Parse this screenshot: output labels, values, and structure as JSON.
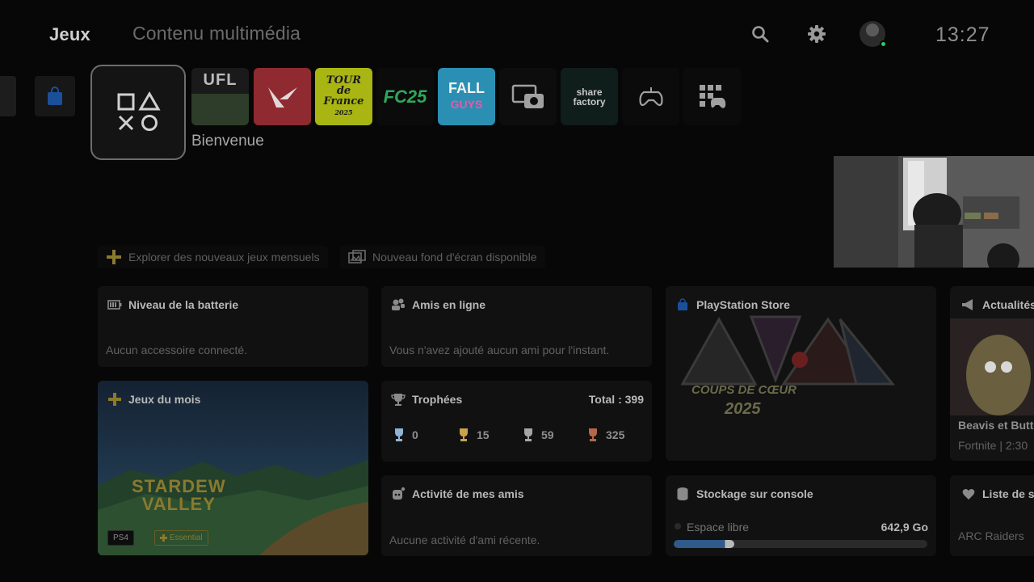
{
  "nav": {
    "tabs": [
      {
        "label": "Jeux"
      },
      {
        "label": "Contenu multimédia"
      }
    ]
  },
  "topbar": {
    "icons": [
      "search-icon",
      "gear-icon"
    ],
    "clock": "13:27",
    "user_status_color": "#2ec862"
  },
  "tiles": {
    "selected_label": "Bienvenue",
    "items": [
      {
        "name": "PlayStation Store",
        "color": "#1b4f9a"
      },
      {
        "name": "Bienvenue",
        "selected": true
      },
      {
        "name": "UFL"
      },
      {
        "name": "Valorant",
        "color": "#ff4655"
      },
      {
        "name": "Tour de France 2025",
        "text": "TOUR de france 2025",
        "color": "#d8e414"
      },
      {
        "name": "EA Sports FC 25",
        "text": "FC25",
        "color": "#2ecc71"
      },
      {
        "name": "Fall Guys",
        "text": "FALL GUYS",
        "color": "#3ec6f0"
      },
      {
        "name": "Capture",
        "icon": "camera-icon"
      },
      {
        "name": "Share Factory",
        "text": "share factory"
      },
      {
        "name": "Manette",
        "icon": "controller-icon"
      },
      {
        "name": "Bibliothèque",
        "icon": "library-icon"
      }
    ]
  },
  "notices": [
    {
      "label": "Explorer des nouveaux jeux mensuels",
      "icon": "ps-plus-icon"
    },
    {
      "label": "Nouveau fond d'écran disponible",
      "icon": "wallpaper-icon"
    }
  ],
  "widgets": {
    "battery": {
      "title": "Niveau de la batterie",
      "body": "Aucun accessoire connecté."
    },
    "friends": {
      "title": "Amis en ligne",
      "body": "Vous n'avez ajouté aucun ami pour l'instant."
    },
    "store": {
      "title": "PlayStation Store",
      "banner_line1": "COUPS DE CŒUR",
      "banner_line2": "2025"
    },
    "news": {
      "title": "Actualités",
      "item_title": "Beavis et Butt-",
      "item_sub": "Fortnite | 2:30"
    },
    "monthly": {
      "title": "Jeux du mois",
      "game": "STARDEW VALLEY",
      "game_line1": "STARDEW",
      "game_line2": "VALLEY",
      "platform": "PS4",
      "tier": "Essential"
    },
    "trophies": {
      "title": "Trophées",
      "total_label": "Total : 399",
      "counts": [
        {
          "kind": "platinum",
          "value": "0",
          "color": "#8fb4d8"
        },
        {
          "kind": "gold",
          "value": "15",
          "color": "#c9a24a"
        },
        {
          "kind": "silver",
          "value": "59",
          "color": "#a6a6a6"
        },
        {
          "kind": "bronze",
          "value": "325",
          "color": "#b5674a"
        }
      ]
    },
    "friend_activity": {
      "title": "Activité de mes amis",
      "body": "Aucune activité d'ami récente."
    },
    "storage": {
      "title": "Stockage sur console",
      "free_label": "Espace libre",
      "free_value": "642,9 Go",
      "used_fraction": 0.24
    },
    "wishlist": {
      "title": "Liste de so",
      "item": "ARC Raiders"
    }
  }
}
